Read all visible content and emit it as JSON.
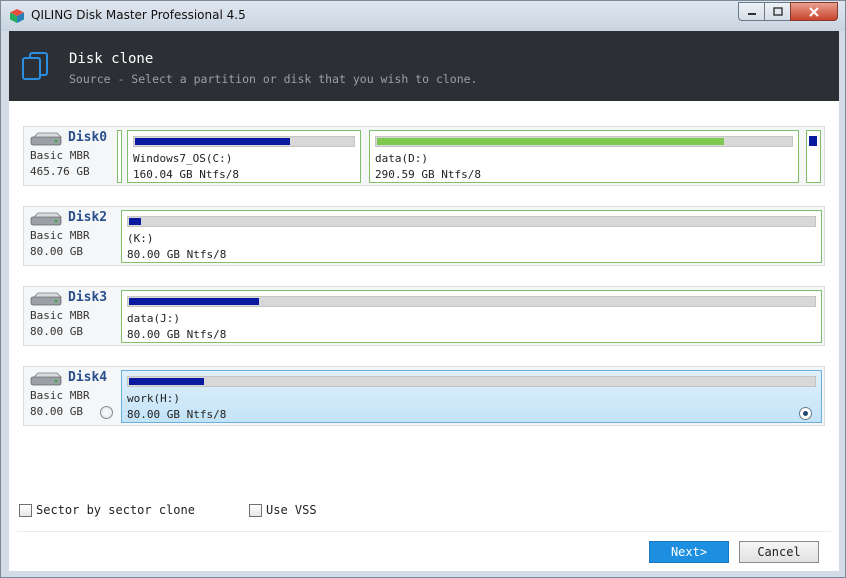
{
  "window": {
    "title": "QILING Disk Master Professional 4.5"
  },
  "header": {
    "title": "Disk clone",
    "subtitle": "Source - Select a partition or disk that you wish to clone."
  },
  "disks": [
    {
      "name": "Disk0",
      "type": "Basic MBR",
      "size": "465.76 GB",
      "partitions": [
        {
          "label": "Windows7_OS(C:)",
          "meta": "160.04 GB Ntfs/8",
          "used_fraction": 0.71,
          "color": "#0a1a9e"
        },
        {
          "label": "data(D:)",
          "meta": "290.59 GB Ntfs/8",
          "used_fraction": 0.84,
          "color": "#7ec850"
        }
      ]
    },
    {
      "name": "Disk2",
      "type": "Basic MBR",
      "size": "80.00 GB",
      "partitions": [
        {
          "label": "(K:)",
          "meta": "80.00 GB Ntfs/8",
          "used_fraction": 0.02,
          "color": "#0a1a9e"
        }
      ]
    },
    {
      "name": "Disk3",
      "type": "Basic MBR",
      "size": "80.00 GB",
      "partitions": [
        {
          "label": "data(J:)",
          "meta": "80.00 GB Ntfs/8",
          "used_fraction": 0.19,
          "color": "#0a1a9e"
        }
      ]
    },
    {
      "name": "Disk4",
      "type": "Basic MBR",
      "size": "80.00 GB",
      "partitions": [
        {
          "label": "work(H:)",
          "meta": "80.00 GB Ntfs/8",
          "used_fraction": 0.11,
          "color": "#0a1a9e",
          "selected": true
        }
      ]
    }
  ],
  "options": {
    "sector_by_sector": {
      "label": "Sector by sector clone",
      "checked": false
    },
    "use_vss": {
      "label": "Use VSS",
      "checked": false
    }
  },
  "buttons": {
    "next": "Next>",
    "cancel": "Cancel"
  },
  "colors": {
    "accent": "#1e8fe0",
    "header_bg": "#2c2f33",
    "partition_border": "#7fbf6a",
    "bar_blue": "#0a1a9e"
  }
}
